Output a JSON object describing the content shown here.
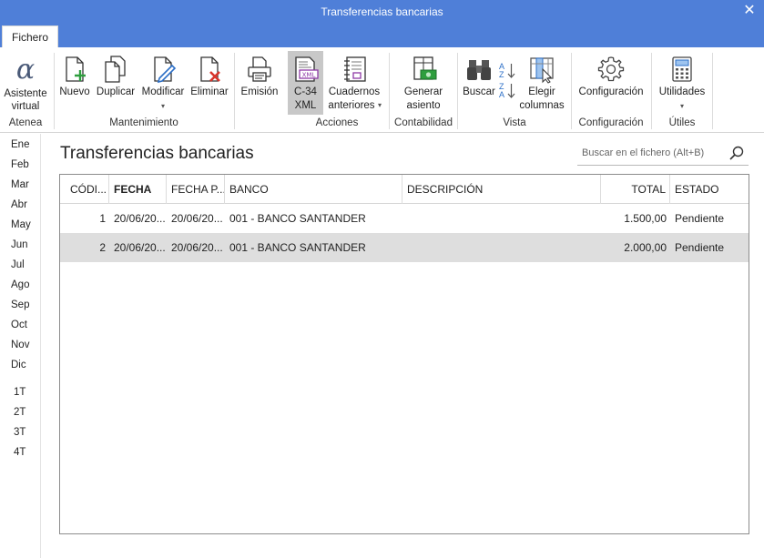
{
  "window": {
    "title": "Transferencias bancarias",
    "close_glyph": "✕"
  },
  "tabs": {
    "file": "Fichero"
  },
  "ribbon": {
    "buttons": {
      "asistente": "Asistente virtual",
      "nuevo": "Nuevo",
      "duplicar": "Duplicar",
      "modificar": "Modificar",
      "eliminar": "Eliminar",
      "emision": "Emisión",
      "c34_line1": "C-34",
      "c34_line2": "XML",
      "cuadernos_line1": "Cuadernos",
      "cuadernos_line2": "anteriores",
      "generar_line1": "Generar",
      "generar_line2": "asiento",
      "buscar": "Buscar",
      "elegir_line1": "Elegir",
      "elegir_line2": "columnas",
      "configuracion": "Configuración",
      "utilidades": "Utilidades",
      "caret": "▾",
      "xml_badge": "XML"
    },
    "groups": {
      "atenea": "Atenea",
      "mantenimiento": "Mantenimiento",
      "acciones": "Acciones",
      "contabilidad": "Contabilidad",
      "vista": "Vista",
      "configuracion": "Configuración",
      "utiles": "Útiles"
    },
    "sort_glyphs": {
      "az_a": "A",
      "az_z": "Z",
      "za_z": "Z",
      "za_a": "A"
    }
  },
  "months": [
    "Ene",
    "Feb",
    "Mar",
    "Abr",
    "May",
    "Jun",
    "Jul",
    "Ago",
    "Sep",
    "Oct",
    "Nov",
    "Dic"
  ],
  "quarters": [
    "1T",
    "2T",
    "3T",
    "4T"
  ],
  "main": {
    "title": "Transferencias bancarias",
    "search_placeholder": "Buscar en el fichero (Alt+B)"
  },
  "table": {
    "columns": {
      "codigo": "CÓDI...",
      "fecha": "FECHA",
      "fecha_p": "FECHA P...",
      "banco": "BANCO",
      "descripcion": "DESCRIPCIÓN",
      "total": "TOTAL",
      "estado": "ESTADO"
    },
    "rows": [
      {
        "codigo": "1",
        "fecha": "20/06/20...",
        "fecha_p": "20/06/20...",
        "banco": "001 - BANCO SANTANDER",
        "descripcion": "",
        "total": "1.500,00",
        "estado": "Pendiente"
      },
      {
        "codigo": "2",
        "fecha": "20/06/20...",
        "fecha_p": "20/06/20...",
        "banco": "001 - BANCO SANTANDER",
        "descripcion": "",
        "total": "2.000,00",
        "estado": "Pendiente"
      }
    ],
    "selected_row": 1
  },
  "colors": {
    "accent": "#4f7fd8",
    "selection": "#dedede",
    "add_green": "#2e9e3e",
    "delete_red": "#d9342b"
  }
}
